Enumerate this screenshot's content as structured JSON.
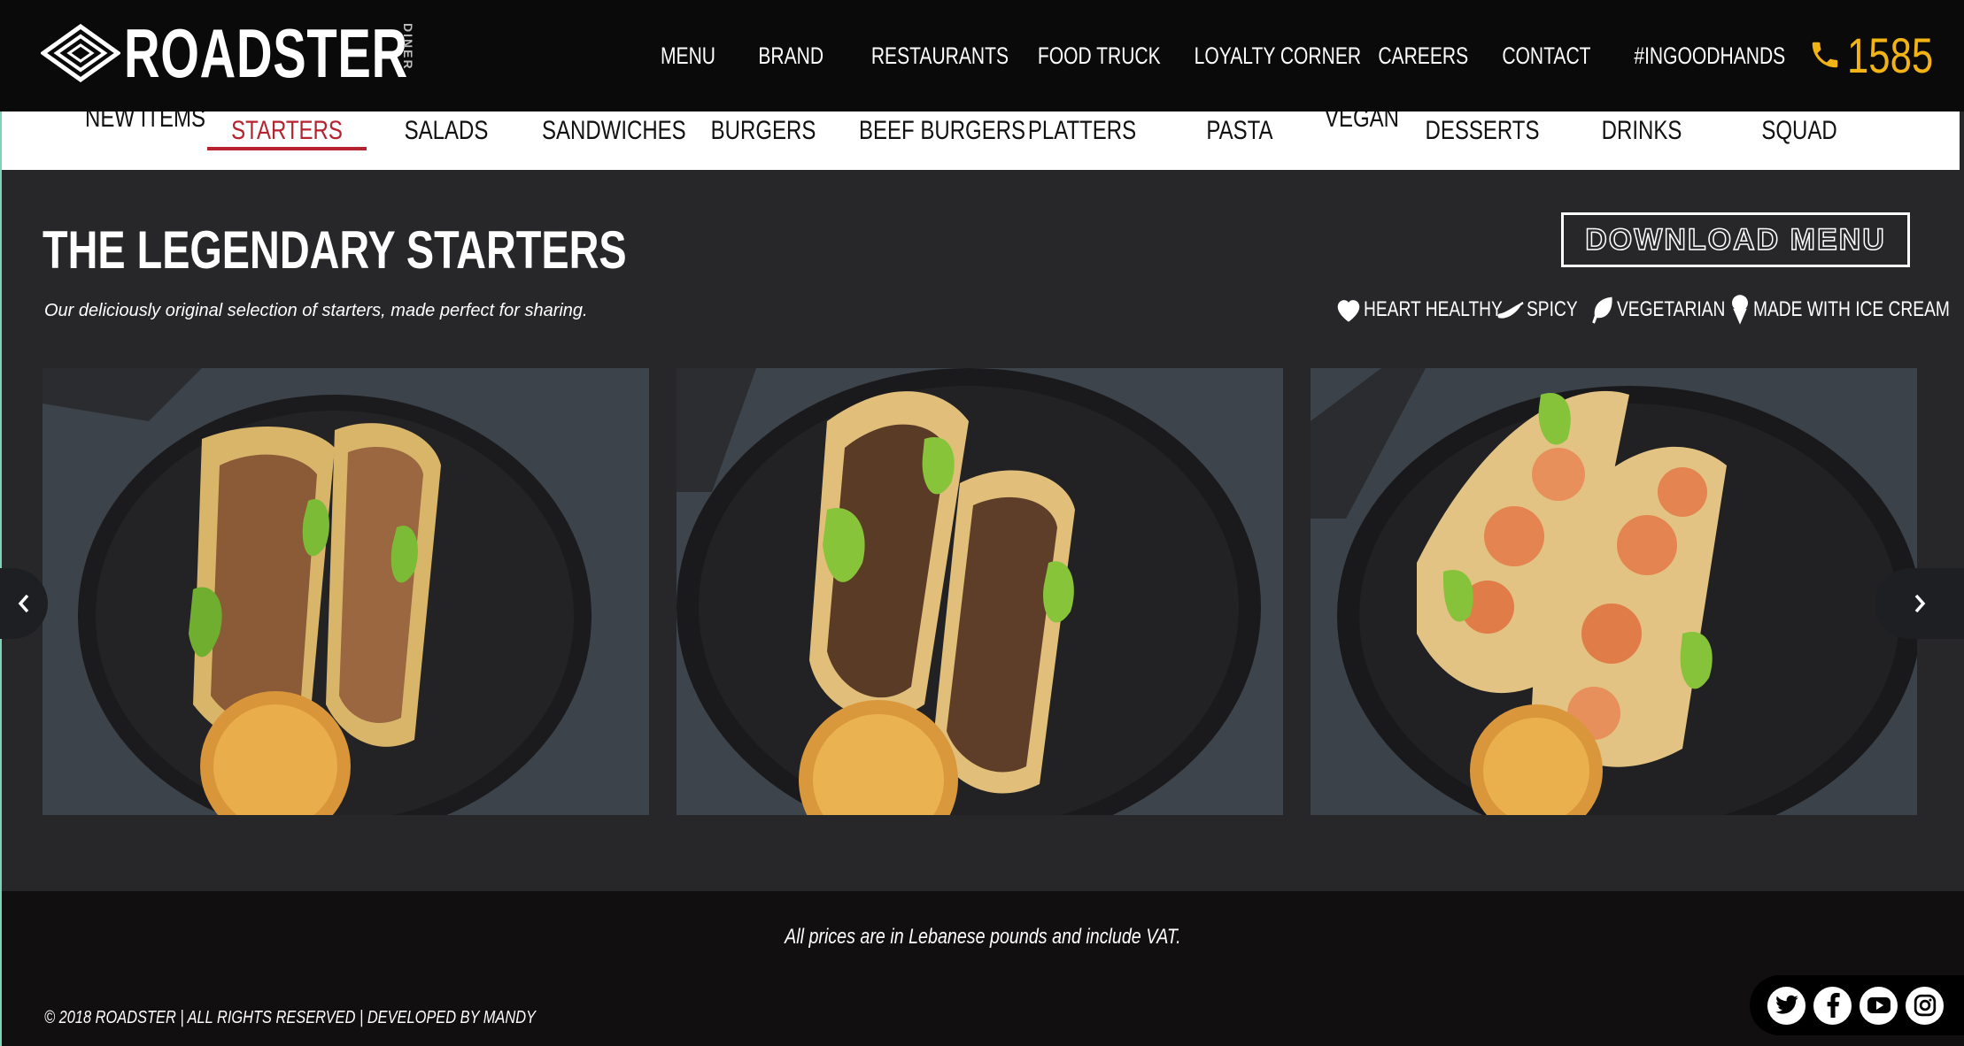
{
  "brand": {
    "name": "ROADSTER",
    "sub": "DINER"
  },
  "main_nav": [
    {
      "label": "MENU"
    },
    {
      "label": "BRAND"
    },
    {
      "label": "RESTAURANTS"
    },
    {
      "label": "FOOD TRUCK"
    },
    {
      "label": "LOYALTY CORNER"
    },
    {
      "label": "CAREERS"
    },
    {
      "label": "CONTACT"
    },
    {
      "label": "#INGOODHANDS"
    }
  ],
  "phone": {
    "number": "1585",
    "icon": "phone-icon",
    "color": "#f2b414"
  },
  "categories": [
    {
      "label": "NEW ITEMS"
    },
    {
      "label": "STARTERS",
      "active": true
    },
    {
      "label": "SALADS"
    },
    {
      "label": "SANDWICHES"
    },
    {
      "label": "BURGERS"
    },
    {
      "label": "BEEF BURGERS"
    },
    {
      "label": "PLATTERS"
    },
    {
      "label": "PASTA"
    },
    {
      "label": "VEGAN"
    },
    {
      "label": "DESSERTS"
    },
    {
      "label": "DRINKS"
    },
    {
      "label": "SQUAD"
    }
  ],
  "section": {
    "title": "THE LEGENDARY STARTERS",
    "subtitle": "Our deliciously original selection of starters, made perfect for sharing.",
    "download_label": "DOWNLOAD MENU"
  },
  "legend": [
    {
      "label": "HEART HEALTHY",
      "icon": "heart-icon"
    },
    {
      "label": "SPICY",
      "icon": "chili-icon"
    },
    {
      "label": "VEGETARIAN",
      "icon": "leaf-icon"
    },
    {
      "label": "MADE WITH ICE CREAM",
      "icon": "ice-cream-icon"
    }
  ],
  "carousel": {
    "items": [
      {
        "image": "chicken-tacos-photo"
      },
      {
        "image": "beef-tacos-photo"
      },
      {
        "image": "shrimp-tacos-photo"
      }
    ]
  },
  "footer": {
    "note": "All prices are in Lebanese pounds and include VAT.",
    "copyright": "© 2018 ROADSTER | ALL RIGHTS RESERVED | DEVELOPED BY MANDY"
  },
  "social": [
    {
      "name": "twitter-icon"
    },
    {
      "name": "facebook-icon"
    },
    {
      "name": "youtube-icon"
    },
    {
      "name": "instagram-icon"
    }
  ],
  "colors": {
    "header_bg": "#0b0a0b",
    "page_bg": "#272729",
    "accent_red": "#b5232f",
    "accent_yellow": "#f2b414"
  }
}
